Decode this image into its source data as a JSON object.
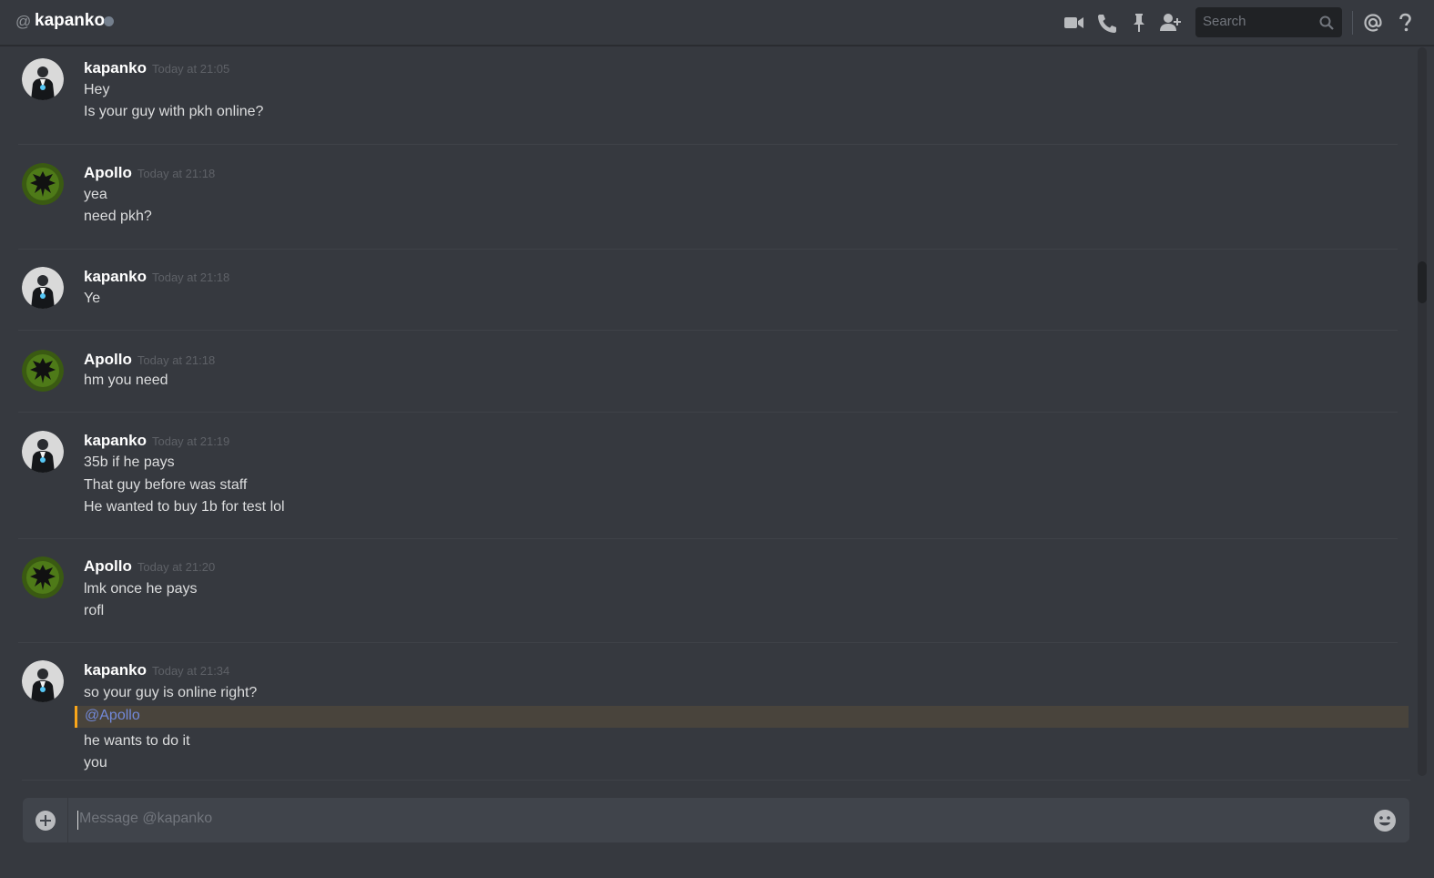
{
  "header": {
    "at_symbol": "@",
    "channel_name": "kapanko",
    "status": "offline",
    "icons": [
      "video-call-icon",
      "voice-call-icon",
      "pin-icon",
      "add-friend-icon",
      "mention-icon",
      "help-icon"
    ],
    "search_placeholder": "Search"
  },
  "messages": [
    {
      "author": "kapanko",
      "avatar": "suited-man-avatar",
      "timestamp": "Today at 21:05",
      "lines": [
        "Hey",
        "Is your guy with pkh online?"
      ]
    },
    {
      "author": "Apollo",
      "avatar": "green-eagle-avatar",
      "timestamp": "Today at 21:18",
      "lines": [
        "yea",
        "need pkh?"
      ]
    },
    {
      "author": "kapanko",
      "avatar": "suited-man-avatar",
      "timestamp": "Today at 21:18",
      "lines": [
        "Ye"
      ]
    },
    {
      "author": "Apollo",
      "avatar": "green-eagle-avatar",
      "timestamp": "Today at 21:18",
      "lines": [
        "hm you need"
      ]
    },
    {
      "author": "kapanko",
      "avatar": "suited-man-avatar",
      "timestamp": "Today at 21:19",
      "lines": [
        "35b if he pays",
        "That guy before was staff",
        "He wanted to buy 1b for test lol"
      ]
    },
    {
      "author": "Apollo",
      "avatar": "green-eagle-avatar",
      "timestamp": "Today at 21:20",
      "lines": [
        "lmk once he pays",
        "rofl"
      ]
    },
    {
      "author": "kapanko",
      "avatar": "suited-man-avatar",
      "timestamp": "Today at 21:34",
      "lines": [
        "so your guy is online right?"
      ],
      "mention": "@Apollo",
      "lines_after": [
        "he wants to do it",
        "you"
      ]
    }
  ],
  "composer": {
    "placeholder": "Message @kapanko",
    "attach_icon": "plus-circle-icon",
    "emoji_icon": "emoji-smile-icon"
  },
  "colors": {
    "background": "#36393f",
    "header_text": "#ffffff",
    "timestamp": "#5e6167",
    "mention_text": "#7289da",
    "mention_highlight": "#49443c",
    "mention_bar": "#faa61a",
    "apollo_avatar": "#3a5a12"
  }
}
